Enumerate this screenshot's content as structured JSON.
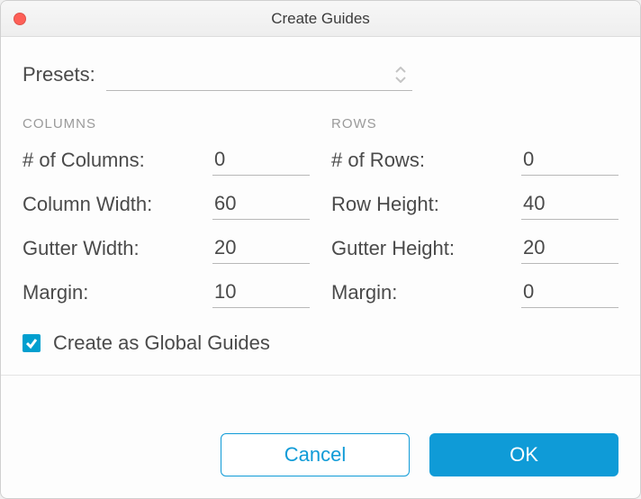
{
  "window": {
    "title": "Create Guides"
  },
  "presets": {
    "label": "Presets:",
    "value": ""
  },
  "columns": {
    "header": "COLUMNS",
    "fields": {
      "count": {
        "label": "# of Columns:",
        "value": "0"
      },
      "width": {
        "label": "Column Width:",
        "value": "60"
      },
      "gutter": {
        "label": "Gutter Width:",
        "value": "20"
      },
      "margin": {
        "label": "Margin:",
        "value": "10"
      }
    }
  },
  "rows": {
    "header": "ROWS",
    "fields": {
      "count": {
        "label": "# of Rows:",
        "value": "0"
      },
      "height": {
        "label": "Row Height:",
        "value": "40"
      },
      "gutter": {
        "label": "Gutter Height:",
        "value": "20"
      },
      "margin": {
        "label": "Margin:",
        "value": "0"
      }
    }
  },
  "checkbox": {
    "label": "Create as Global Guides",
    "checked": true
  },
  "buttons": {
    "cancel": "Cancel",
    "ok": "OK"
  }
}
